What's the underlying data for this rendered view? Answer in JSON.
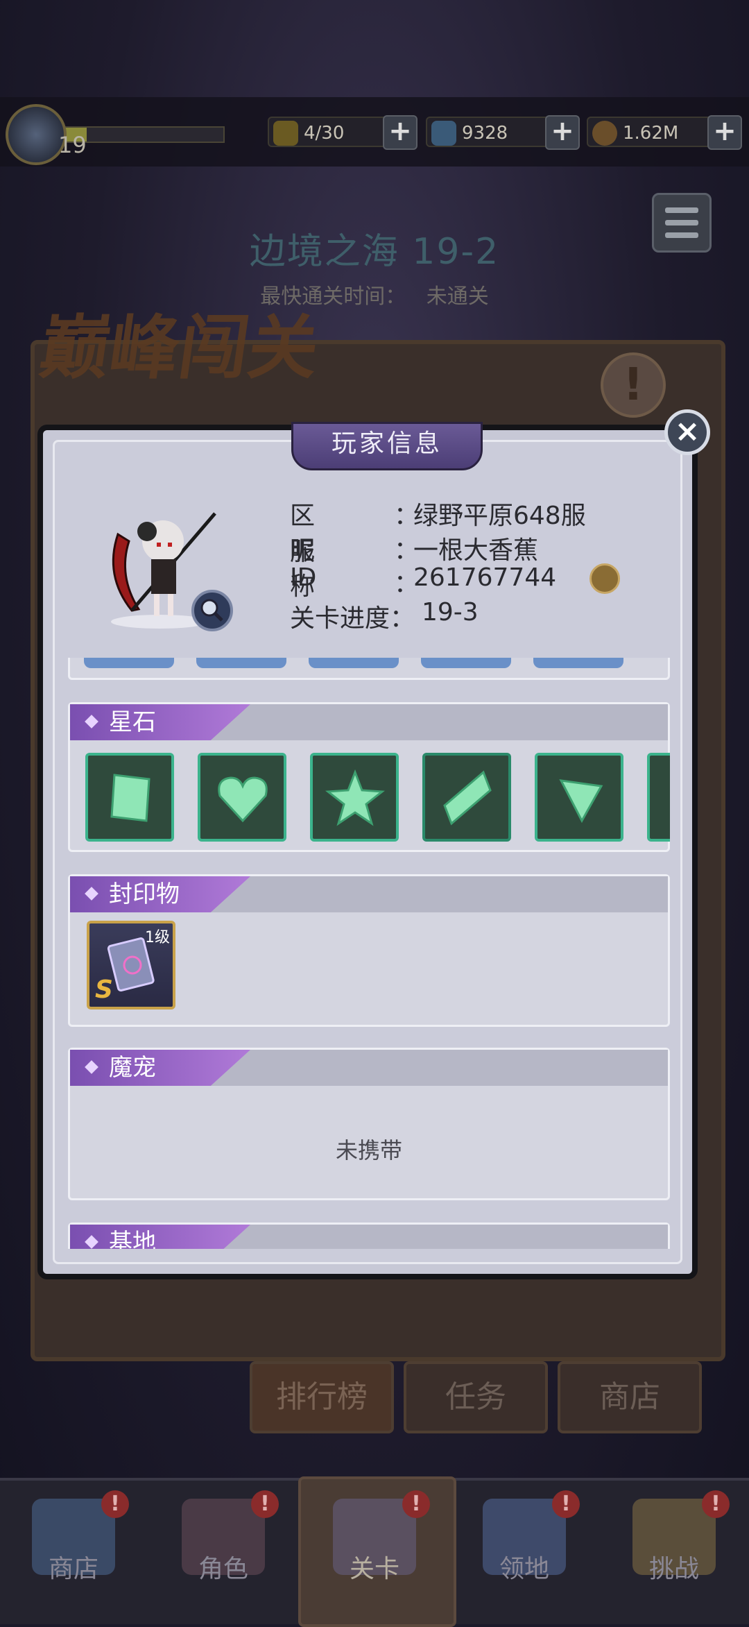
{
  "top_bar": {
    "player_level": "19",
    "xp_progress": 0.18,
    "stamina": "4/30",
    "diamonds": "9328",
    "gold": "1.62M",
    "plus_label": "+"
  },
  "stage": {
    "title": "边境之海 19-2",
    "fastest_label": "最快通关时间：",
    "fastest_value": "未通关"
  },
  "banner_text": "巅峰闯关",
  "behind_tabs": {
    "leaderboard": "排行榜",
    "tasks": "任务",
    "shop": "商店"
  },
  "modal": {
    "title": "玩家信息",
    "close_label": "×",
    "info": [
      {
        "key": "区服",
        "sep": "：",
        "value": "绿野平原648服"
      },
      {
        "key": "昵称",
        "sep": "：",
        "value": "一根大香蕉"
      },
      {
        "key": "ID",
        "sep": "：",
        "value": "261767744"
      },
      {
        "key": "关卡进度：",
        "sep": "",
        "value": "19-3"
      }
    ],
    "sections": {
      "star_stone": {
        "title": "星石",
        "gems": [
          "square",
          "heart",
          "star",
          "diamond",
          "triangle"
        ]
      },
      "seal": {
        "title": "封印物",
        "item_level": "1级",
        "item_rank": "S"
      },
      "pet": {
        "title": "魔宠",
        "empty_text": "未携带"
      },
      "base": {
        "title": "基地"
      }
    }
  },
  "nav": {
    "shop": "商店",
    "role": "角色",
    "stage": "关卡",
    "territory": "领地",
    "challenge": "挑战",
    "badge": "!"
  },
  "colors": {
    "modal_bg": "#c7c8d6",
    "section_label": "#9a62c8",
    "gem_border": "#3bb38c"
  }
}
